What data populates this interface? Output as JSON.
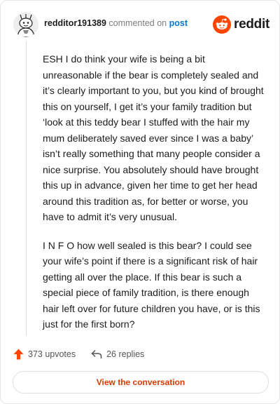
{
  "comment": {
    "username": "redditor191389",
    "action_text": "commented on",
    "post_link": "post",
    "paragraphs": [
      "ESH I do think your wife is being a bit unreasonable if the bear is completely sealed and it’s clearly important to you, but you kind of brought this on yourself, I get it’s your family tradition but ‘look at this teddy bear I stuffed with the hair my mum deliberately saved ever since I was a baby’ isn’t really something that many people consider a nice surprise. You absolutely should have brought this up in advance, given her time to get her head around this tradition as, for better or worse, you have to admit it’s very unusual.",
      "I N F O how well sealed is this bear? I could see your wife’s point if there is a significant risk of hair getting all over the place. If this bear is such a special piece of family tradition, is there enough hair left over for future children you have, or is this just for the first born?"
    ]
  },
  "brand": {
    "name": "reddit",
    "color": "#ff4500",
    "icon": "reddit-logo-icon"
  },
  "stats": {
    "upvotes": "373 upvotes",
    "replies": "26 replies",
    "upvote_color": "#ff4500"
  },
  "cta": {
    "label": "View the conversation",
    "color": "#d93a00"
  }
}
